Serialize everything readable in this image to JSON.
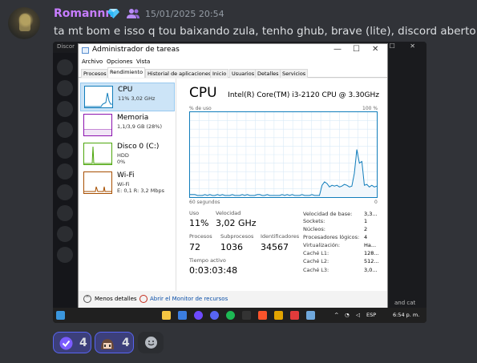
{
  "message": {
    "username": "Romannn",
    "timestamp": "15/01/2025 20:54",
    "text": "ta mt bom e isso q tou baixando zula, tenho ghub, brave (lite), discord aberto",
    "badge_icons": [
      "nitro-gem-icon",
      "group-icon"
    ],
    "username_color": "#c77dff"
  },
  "background_app": {
    "title_fragment": "Discor",
    "side_fragments": [
      "Discor",
      "Discor"
    ],
    "right_fragment": "and cat"
  },
  "task_manager": {
    "window_title": "Administrador de tareas",
    "menu": [
      "Archivo",
      "Opciones",
      "Vista"
    ],
    "tabs": [
      "Procesos",
      "Rendimiento",
      "Historial de aplicaciones",
      "Inicio",
      "Usuarios",
      "Detalles",
      "Servicios"
    ],
    "active_tab": "Rendimiento",
    "sidebar": [
      {
        "name": "CPU",
        "line1": "11% 3,02 GHz",
        "line2": "",
        "color": "#117dbb"
      },
      {
        "name": "Memoria",
        "line1": "1,1/3,9 GB (28%)",
        "line2": "",
        "color": "#8b12ae"
      },
      {
        "name": "Disco 0 (C:)",
        "line1": "HDD",
        "line2": "0%",
        "color": "#4da60c"
      },
      {
        "name": "Wi-Fi",
        "line1": "Wi-Fi",
        "line2": "E: 0,1 R: 3,2 Mbps",
        "color": "#a74f01"
      }
    ],
    "header": {
      "title": "CPU",
      "model": "Intel(R) Core(TM) i3-2120 CPU @ 3.30GHz"
    },
    "graph_labels": {
      "top_left": "% de uso",
      "top_right": "100 %",
      "bottom_left": "60 segundos",
      "bottom_right": "0"
    },
    "stats": {
      "uso_label": "Uso",
      "uso_value": "11%",
      "velocidad_label": "Velocidad",
      "velocidad_value": "3,02 GHz",
      "procesos_label": "Procesos",
      "procesos_value": "72",
      "subprocesos_label": "Subprocesos",
      "subprocesos_value": "1036",
      "identificadores_label": "Identificadores",
      "identificadores_value": "34567",
      "tiempo_label": "Tiempo activo",
      "tiempo_value": "0:03:03:48"
    },
    "specs": [
      {
        "label": "Velocidad de base:",
        "value": "3,3..."
      },
      {
        "label": "Sockets:",
        "value": "1"
      },
      {
        "label": "Núcleos:",
        "value": "2"
      },
      {
        "label": "Procesadores lógicos:",
        "value": "4"
      },
      {
        "label": "Virtualización:",
        "value": "Ha..."
      },
      {
        "label": "Caché L1:",
        "value": "128..."
      },
      {
        "label": "Caché L2:",
        "value": "512..."
      },
      {
        "label": "Caché L3:",
        "value": "3,0..."
      }
    ],
    "footer": {
      "fewer_details": "Menos detalles",
      "resource_monitor": "Abrir el Monitor de recursos"
    }
  },
  "taskbar": {
    "language": "ESP",
    "time": "6:54 p. m.",
    "icons": [
      "windows-start-icon",
      "file-explorer-icon",
      "photo-icon",
      "proton-vpn-icon",
      "discord-icon",
      "spotify-icon",
      "xbox-icon",
      "brave-icon",
      "zula-icon",
      "blitz-icon",
      "taskmanager-icon"
    ]
  },
  "reactions": [
    {
      "icon": "verified-check-emoji-icon",
      "count": "4",
      "active": true
    },
    {
      "icon": "anime-face-emoji-icon",
      "count": "4",
      "active": true
    }
  ],
  "cpu_usage_series": [
    3,
    3,
    3,
    2,
    2,
    2,
    3,
    2,
    3,
    2,
    2,
    3,
    2,
    3,
    2,
    2,
    2,
    3,
    2,
    2,
    2,
    3,
    2,
    3,
    2,
    2,
    2,
    3,
    3,
    2,
    2,
    3,
    2,
    2,
    2,
    2,
    2,
    3,
    2,
    3,
    2,
    3,
    2,
    2,
    2,
    3,
    2,
    2,
    2,
    3,
    2,
    2,
    2,
    14,
    18,
    16,
    12,
    14,
    13,
    14,
    12,
    13,
    15,
    14,
    12,
    13,
    28,
    56,
    40,
    42,
    14,
    15,
    12,
    14,
    12,
    13
  ]
}
